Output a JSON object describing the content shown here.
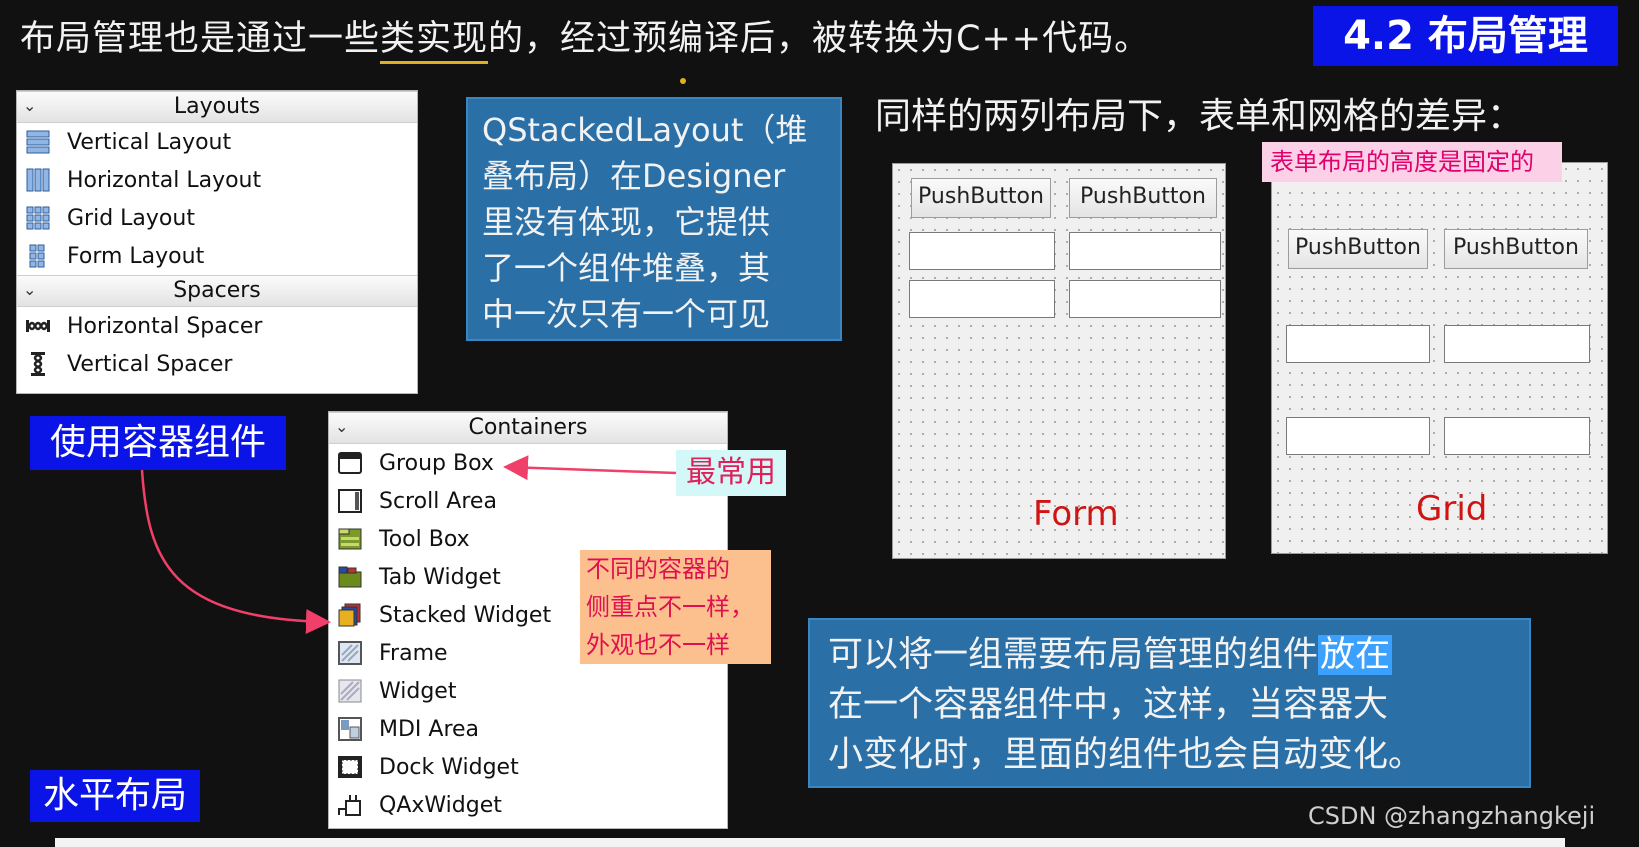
{
  "header": {
    "text_part1": "布局管理也是通过一些",
    "text_underlined": "类实现",
    "text_part2": "的，经过预编译后，被转换为C++代码。",
    "section_title": "4.2 布局管理"
  },
  "layouts_panel": {
    "header": "Layouts",
    "items": [
      {
        "label": "Vertical Layout",
        "icon": "vertical-layout-icon"
      },
      {
        "label": "Horizontal Layout",
        "icon": "horizontal-layout-icon"
      },
      {
        "label": "Grid Layout",
        "icon": "grid-layout-icon"
      },
      {
        "label": "Form Layout",
        "icon": "form-layout-icon"
      }
    ],
    "spacers_header": "Spacers",
    "spacers": [
      {
        "label": "Horizontal Spacer",
        "icon": "horizontal-spacer-icon"
      },
      {
        "label": "Vertical Spacer",
        "icon": "vertical-spacer-icon"
      }
    ]
  },
  "stacked_note": {
    "lines": [
      "QStackedLayout（堆",
      "叠布局）在Designer",
      "里没有体现，它提供",
      "了一个组件堆叠，其",
      "中一次只有一个可见"
    ]
  },
  "compare": {
    "title": "同样的两列布局下，表单和网格的差异：",
    "grid_note": "表单布局的高度是固定的",
    "form_caption": "Form",
    "grid_caption": "Grid",
    "button_label": "PushButton"
  },
  "tags": {
    "use_containers": "使用容器组件",
    "horizontal_layout": "水平布局",
    "most_used": "最常用"
  },
  "containers_panel": {
    "header": "Containers",
    "items": [
      {
        "label": "Group Box",
        "icon": "group-box-icon"
      },
      {
        "label": "Scroll Area",
        "icon": "scroll-area-icon"
      },
      {
        "label": "Tool Box",
        "icon": "tool-box-icon"
      },
      {
        "label": "Tab Widget",
        "icon": "tab-widget-icon"
      },
      {
        "label": "Stacked Widget",
        "icon": "stacked-widget-icon"
      },
      {
        "label": "Frame",
        "icon": "frame-icon"
      },
      {
        "label": "Widget",
        "icon": "widget-icon"
      },
      {
        "label": "MDI Area",
        "icon": "mdi-area-icon"
      },
      {
        "label": "Dock Widget",
        "icon": "dock-widget-icon"
      },
      {
        "label": "QAxWidget",
        "icon": "qaxwidget-icon"
      }
    ]
  },
  "diff_note": {
    "lines": [
      "不同的容器的",
      "侧重点不一样，",
      "外观也不一样"
    ]
  },
  "container_note": {
    "line1_before": "可以将一组需要布局管理的组件",
    "line1_highlight": "放在",
    "line2": "在一个容器组件中，这样，当容器大",
    "line3": "小变化时，里面的组件也会自动变化。"
  },
  "watermark": "CSDN @zhangzhangkeji",
  "colors": {
    "background": "#111111",
    "blue_tag": "#0a14e6",
    "note_blue": "#2a6fa6",
    "caption_red": "#d01414",
    "pink_note": "#fcd0e6",
    "orange_note": "#fcc08f",
    "arrow": "#f0406a"
  }
}
